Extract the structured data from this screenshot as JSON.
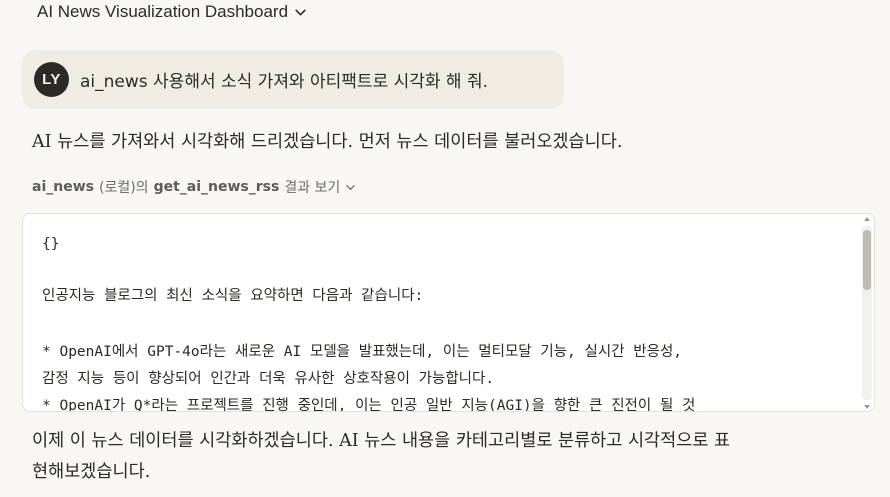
{
  "header": {
    "title": "AI News Visualization Dashboard",
    "icon": "chevron-down-icon"
  },
  "user_message": {
    "avatar_initials": "LY",
    "text": "ai_news 사용해서 소식 가져와 아티팩트로 시각화 해 줘."
  },
  "assistant": {
    "intro": "AI 뉴스를 가져와서 시각화해 드리겠습니다. 먼저 뉴스 데이터를 불러오겠습니다.",
    "followup_line1": "이제 이 뉴스 데이터를 시각화하겠습니다. AI 뉴스 내용을 카테고리별로 분류하고 시각적으로 표",
    "followup_line2": "현해보겠습니다."
  },
  "tool_call": {
    "server": "ai_news",
    "server_suffix": "(로컬)의",
    "tool_name": "get_ai_news_rss",
    "action": "결과 보기"
  },
  "tool_result": {
    "lines": [
      "{}",
      "인공지능 블로그의 최신 소식을 요약하면 다음과 같습니다:",
      "* OpenAI에서 GPT-4o라는 새로운 AI 모델을 발표했는데, 이는 멀티모달 기능, 실시간 반응성,",
      "감정 지능 등이 향상되어 인간과 더욱 유사한 상호작용이 가능합니다.",
      "* OpenAI가 Q*라는 프로젝트를 진행 중인데, 이는 인공 일반 지능(AGI)을 향한 큰 진전이 될 것"
    ]
  }
}
